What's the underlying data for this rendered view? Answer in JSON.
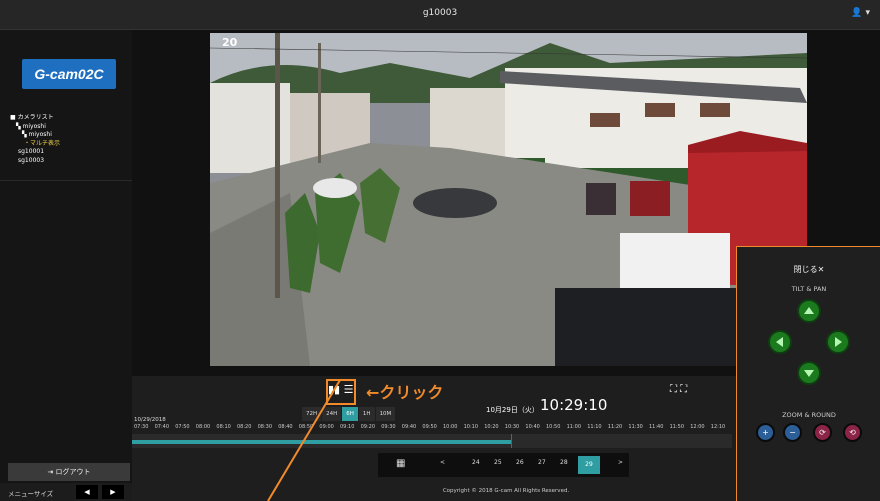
{
  "window": {
    "title": "g10003",
    "user_icon": "user-icon"
  },
  "sidebar": {
    "logo": "G-cam02C",
    "tree": [
      {
        "label": "カメラリスト",
        "level": 1
      },
      {
        "label": "miyoshi",
        "level": 2
      },
      {
        "label": "miyoshi",
        "level": 3
      },
      {
        "label": "・マルチ表示",
        "level": 4
      },
      {
        "label": "sg10001",
        "level": 5
      },
      {
        "label": "sg10003",
        "level": 5
      }
    ],
    "logout": "ログアウト",
    "menu_size_label": "メニューサイズ",
    "menu_prev": "◀",
    "menu_next": "▶"
  },
  "video": {
    "overlay_timestamp": "20"
  },
  "controls": {
    "pause_label": "▮▮",
    "menu_label": "☰",
    "annotation": "←クリック",
    "fullscreen": "⛶ ⛶",
    "ranges": [
      "72H",
      "24H",
      "6H",
      "1H",
      "10M"
    ],
    "active_range": "6H",
    "date": "10月29日（火）",
    "time": "10:29:10",
    "timeline_label": "10/29/2018",
    "ticks": [
      "07:30",
      "07:40",
      "07:50",
      "08:00",
      "08:10",
      "08:20",
      "08:30",
      "08:40",
      "08:50",
      "09:00",
      "09:10",
      "09:20",
      "09:30",
      "09:40",
      "09:50",
      "10:00",
      "10:10",
      "10:20",
      "10:30",
      "10:40",
      "10:50",
      "11:00",
      "11:10",
      "11:20",
      "11:30",
      "11:40",
      "11:50",
      "12:00",
      "12:10"
    ],
    "pager": {
      "calendar": "📅",
      "prev": "<",
      "days": [
        "24",
        "25",
        "26",
        "27",
        "28"
      ],
      "current": "29",
      "next": ">"
    },
    "copyright": "Copyright © 2018 G-cam All Rights Reserved."
  },
  "ptz": {
    "close": "閉じる✕",
    "tilt_pan": "TILT & PAN",
    "zoom_round": "ZOOM & ROUND",
    "zoom_buttons": [
      "+",
      "−",
      "⟳",
      "⟲"
    ]
  },
  "colors": {
    "accent": "#2e9ea3",
    "annotation": "#f08a2a",
    "logo": "#1e6fc0",
    "arrow": "#1c7a1e"
  }
}
